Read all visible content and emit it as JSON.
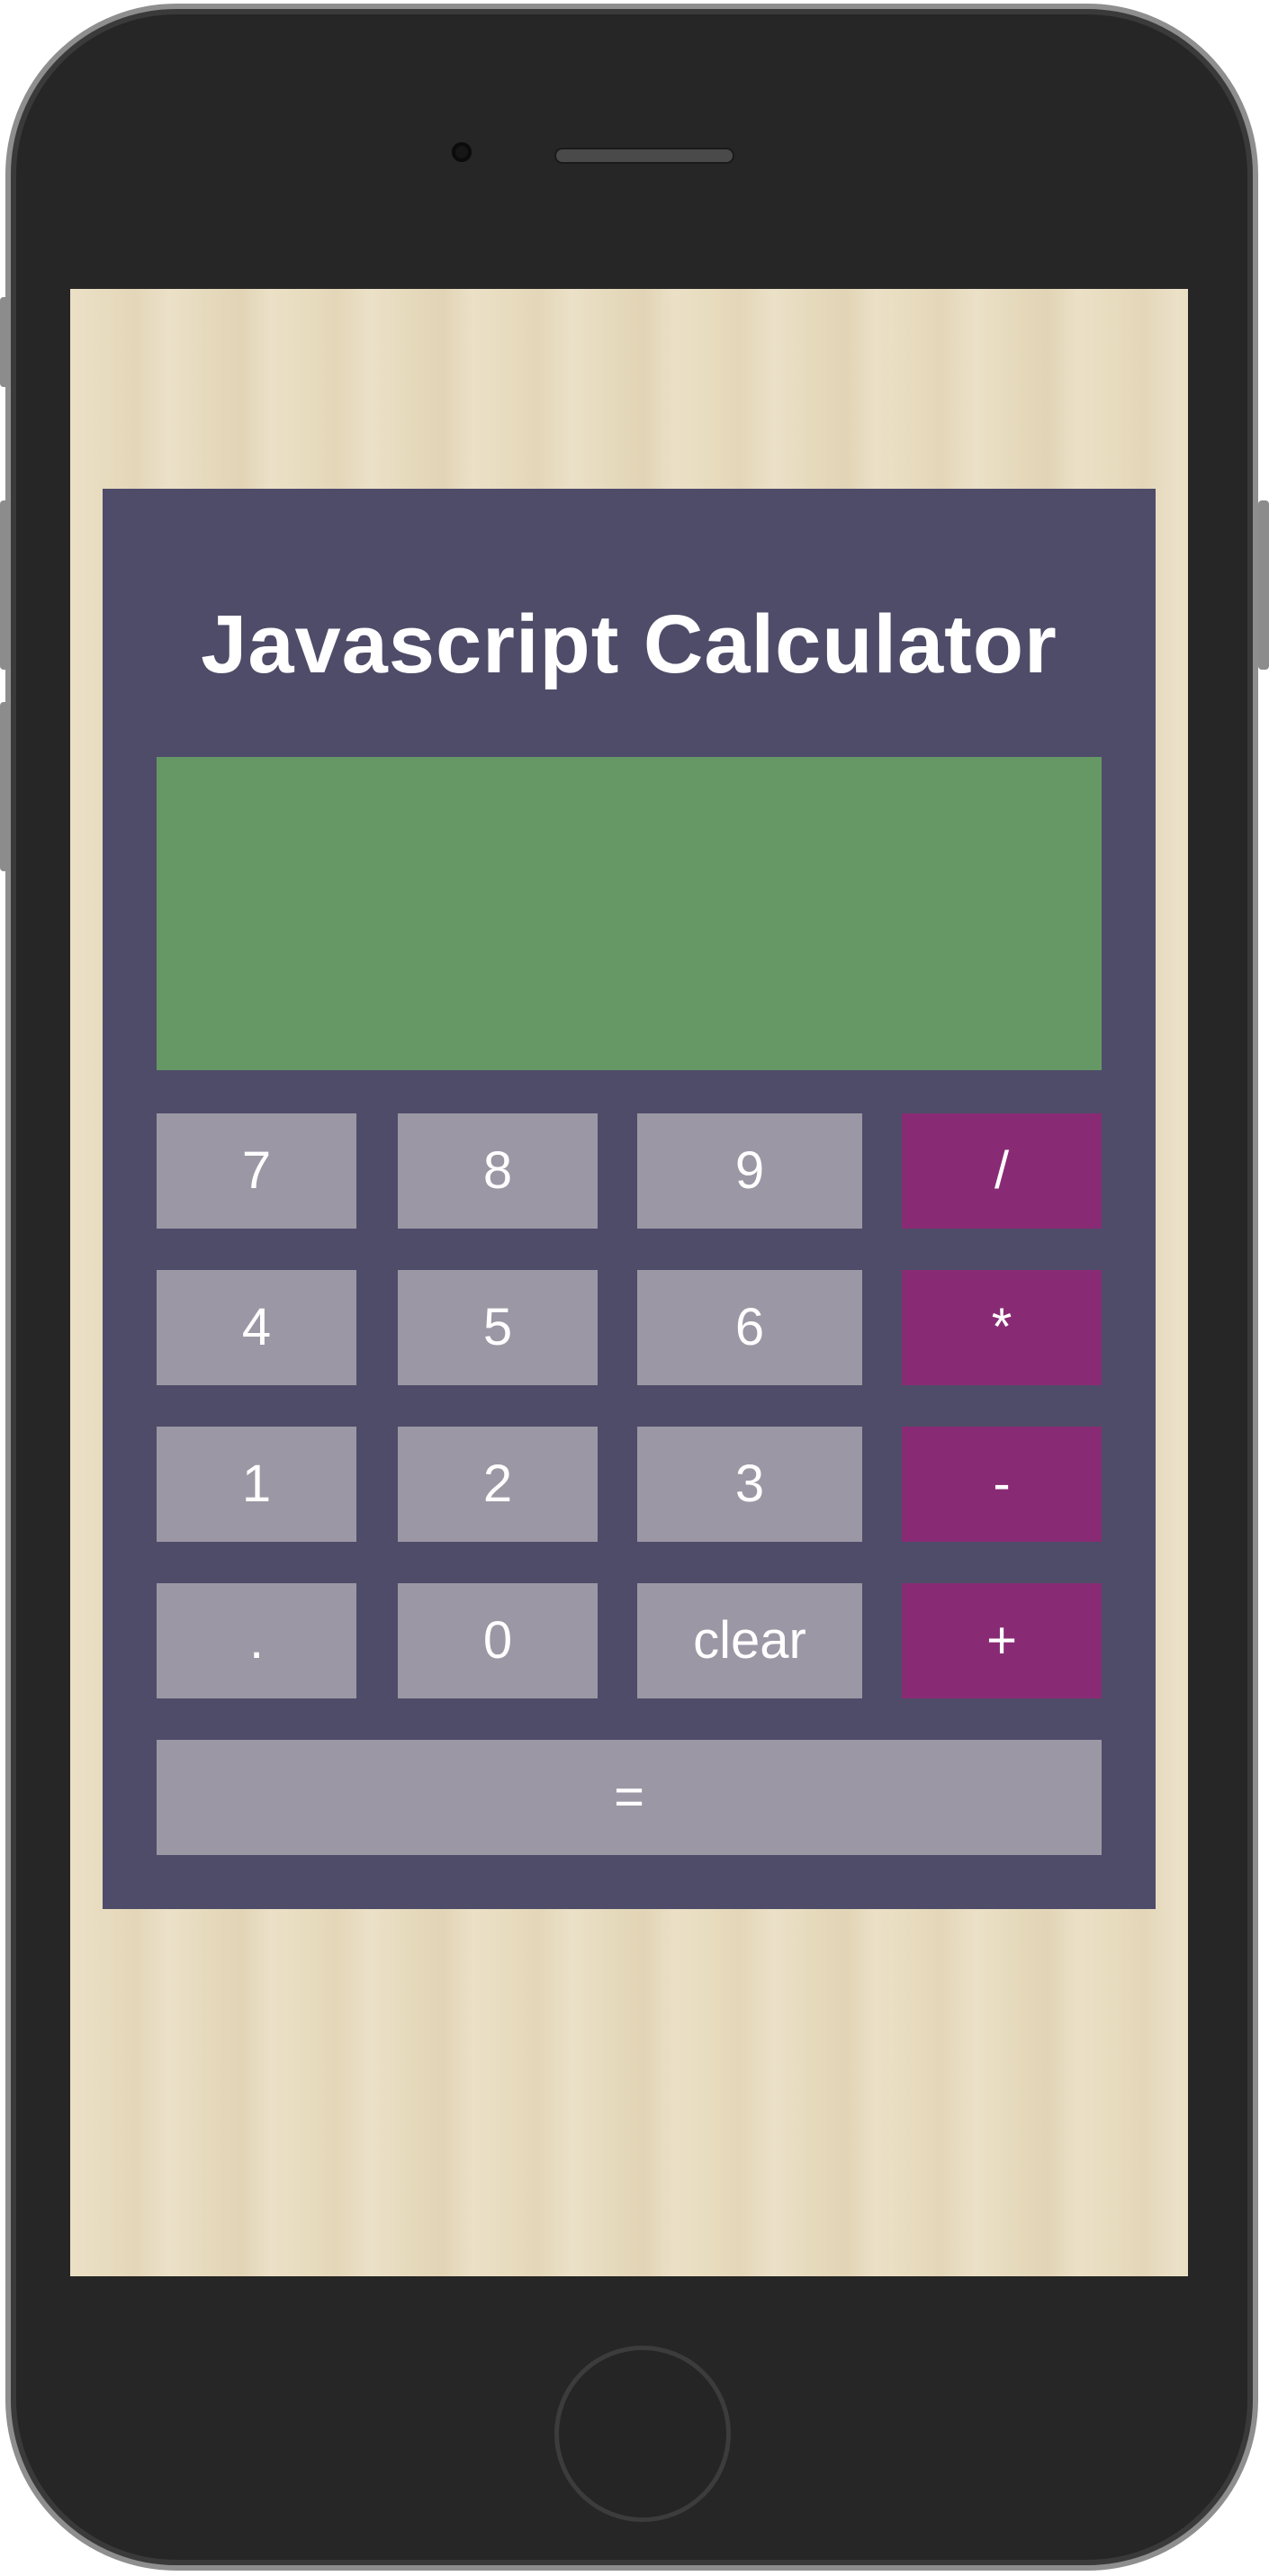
{
  "app": {
    "title": "Javascript Calculator",
    "display_value": ""
  },
  "keys": {
    "seven": "7",
    "eight": "8",
    "nine": "9",
    "divide": "/",
    "four": "4",
    "five": "5",
    "six": "6",
    "multiply": "*",
    "one": "1",
    "two": "2",
    "three": "3",
    "subtract": "-",
    "decimal": ".",
    "zero": "0",
    "clear": "clear",
    "add": "+",
    "equals": "="
  },
  "colors": {
    "panel": "#4f4c69",
    "display": "#669865",
    "number_key": "#9b97a4",
    "operator_key": "#892b74",
    "background": "#ebe0c6"
  }
}
